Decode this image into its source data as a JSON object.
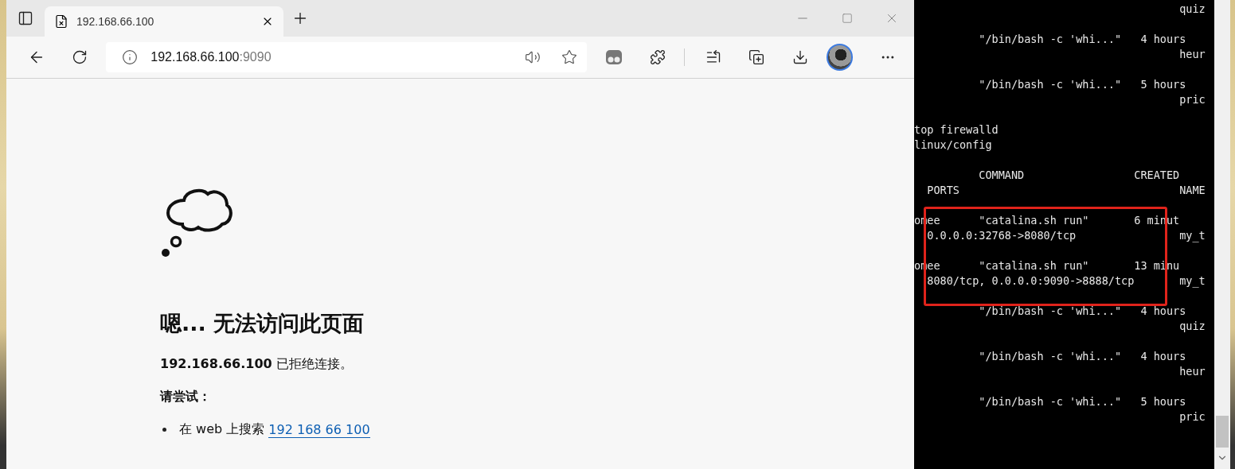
{
  "browser": {
    "tab": {
      "title": "192.168.66.100",
      "selected": true
    },
    "address": {
      "host": "192.168.66.100",
      "port": ":9090"
    },
    "error_page": {
      "heading": "嗯... 无法访问此页面",
      "message": "**192.168.66.100** 已拒绝连接。",
      "try_label": "请尝试：",
      "suggestions": [
        {
          "text": "在 web 上搜索 ",
          "link": "192 168 66 100"
        }
      ]
    }
  },
  "terminal": {
    "blocks": [
      [
        "                                         quiz"
      ],
      [
        "          \"/bin/bash -c 'whi...\"   4 hours",
        "                                         heur"
      ],
      [
        "          \"/bin/bash -c 'whi...\"   5 hours",
        "                                         pric"
      ],
      [
        "top firewalld",
        "linux/config"
      ],
      [
        "          COMMAND                 CREATED",
        "  PORTS                                  NAME"
      ],
      [
        "omee      \"catalina.sh run\"       6 minut",
        "  0.0.0.0:32768->8080/tcp                my_t"
      ],
      [
        "omee      \"catalina.sh run\"       13 minu",
        "  8080/tcp, 0.0.0.0:9090->8888/tcp       my_t"
      ],
      [
        "          \"/bin/bash -c 'whi...\"   4 hours",
        "                                         quiz"
      ],
      [
        "          \"/bin/bash -c 'whi...\"   4 hours",
        "                                         heur"
      ],
      [
        "          \"/bin/bash -c 'whi...\"   5 hours",
        "                                         pric"
      ]
    ]
  }
}
